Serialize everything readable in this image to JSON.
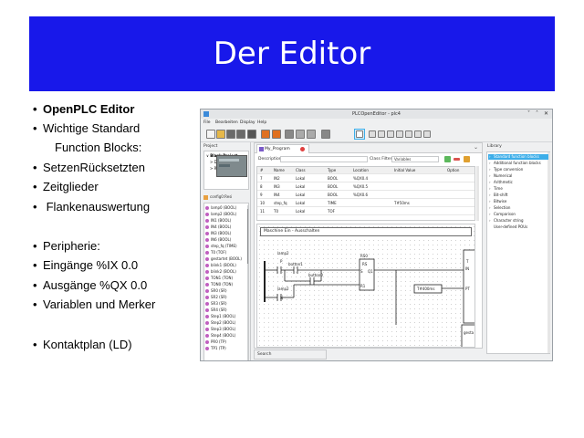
{
  "slide": {
    "title": "Der Editor",
    "banner_color": "#1818ea",
    "bullets": [
      {
        "bullet": "•",
        "text": "OpenPLC Editor",
        "bold": true
      },
      {
        "bullet": "•",
        "text": "Wichtige Standard"
      },
      {
        "bullet": "",
        "text": "Function Blocks:"
      },
      {
        "bullet": "•",
        "text": "SetzenRücksetzten"
      },
      {
        "bullet": "•",
        "text": "Zeitglieder"
      },
      {
        "bullet": "•",
        "text": " Flankenauswertung"
      },
      {
        "bullet": "•",
        "text": "Peripherie:"
      },
      {
        "bullet": "•",
        "text": "Eingänge %IX 0.0"
      },
      {
        "bullet": "•",
        "text": "Ausgänge %QX 0.0"
      },
      {
        "bullet": "•",
        "text": "Variablen und Merker"
      },
      {
        "bullet": "•",
        "text": "Kontaktplan (LD)"
      }
    ]
  },
  "app": {
    "window_title": "PLCOpenEditor - plc4",
    "window_buttons": [
      "˅",
      "˄",
      "✕"
    ],
    "menu": [
      "File",
      "Bearbeiten",
      "Display",
      "Help"
    ],
    "toolbar_icons": [
      "new-icon",
      "open-icon",
      "save-icon",
      "save-as-icon",
      "print-icon",
      "undo-icon",
      "redo-icon",
      "cut-icon",
      "copy-icon",
      "paste-icon",
      "search-icon",
      "select-icon",
      "comment-icon",
      "variable-icon",
      "block-icon",
      "connection-icon",
      "power-rail-icon",
      "contact-icon",
      "coil-icon"
    ],
    "project_panel": {
      "header": "Project",
      "tree": [
        {
          "label": "Blank Project",
          "indent": 0,
          "expander": "∨"
        },
        {
          "label": "D...",
          "indent": 1,
          "expander": ">"
        },
        {
          "label": "R...",
          "indent": 1,
          "expander": ">"
        }
      ],
      "config_label": "config0:Resi",
      "variables": [
        "lamp0 (BOOL)",
        "lamp2 (BOOL)",
        "IN1 (BOOL)",
        "IN4 (BOOL)",
        "IN3 (BOOL)",
        "IN6 (BOOL)",
        "step_fq (TIME)",
        "T0 (TOF)",
        "gestartet (BOOL)",
        "blink1 (BOOL)",
        "blink2 (BOOL)",
        "TON1 (TON)",
        "TON0 (TON)",
        "SR0 (SR)",
        "SR2 (SR)",
        "SR3 (SR)",
        "SR4 (SR)",
        "Step1 (BOOL)",
        "Step2 (BOOL)",
        "Step3 (BOOL)",
        "Step4 (BOOL)",
        "PR0 (TP)",
        "TP1 (TP)"
      ],
      "search_label": "Search"
    },
    "editor": {
      "tab_label": "My_Program",
      "description_label": "Description:",
      "class_filter_label": "Class Filter:",
      "class_filter_value": "Variables",
      "table": {
        "headers": [
          "#",
          "Name",
          "Class",
          "Type",
          "Location",
          "Initial Value",
          "Option"
        ],
        "rows": [
          [
            "7",
            "IN2",
            "Lokal",
            "BOOL",
            "%QX0.4",
            "",
            ""
          ],
          [
            "8",
            "IN3",
            "Lokal",
            "BOOL",
            "%QX0.5",
            "",
            ""
          ],
          [
            "9",
            "IN4",
            "Lokal",
            "BOOL",
            "%QX0.6",
            "",
            ""
          ],
          [
            "10",
            "step_fq",
            "Lokal",
            "TIME",
            "",
            "T#50ms",
            ""
          ],
          [
            "11",
            "T0",
            "Lokal",
            "TOF",
            "",
            "",
            ""
          ]
        ]
      },
      "ladder": {
        "header": "Maschine Ein - Ausschalten",
        "labels": {
          "c1": "lamp2",
          "c1_sub": "P",
          "c2": "button1",
          "c3": "button0",
          "c4": "lamp2",
          "c4_sub": "N",
          "sr_name": "RS0",
          "sr_type": "RS",
          "sr_s": "S",
          "sr_r": "R1",
          "sr_q": "Q1",
          "timer_pt": "T#400ms",
          "fb_t": "T",
          "fb_in": "IN",
          "fb_pt": "PT",
          "fb_out": "gesta"
        }
      }
    },
    "library": {
      "header": "Library",
      "items": [
        {
          "label": "Standard function blocks",
          "selected": true
        },
        {
          "label": "Additional function blocks"
        },
        {
          "label": "Type conversion"
        },
        {
          "label": "Numerical"
        },
        {
          "label": "Arithmetic"
        },
        {
          "label": "Time"
        },
        {
          "label": "Bit-shift"
        },
        {
          "label": "Bitwise"
        },
        {
          "label": "Selection"
        },
        {
          "label": "Comparison"
        },
        {
          "label": "Character string"
        },
        {
          "label": "User-defined POUs",
          "no_arrow": true
        }
      ]
    }
  }
}
